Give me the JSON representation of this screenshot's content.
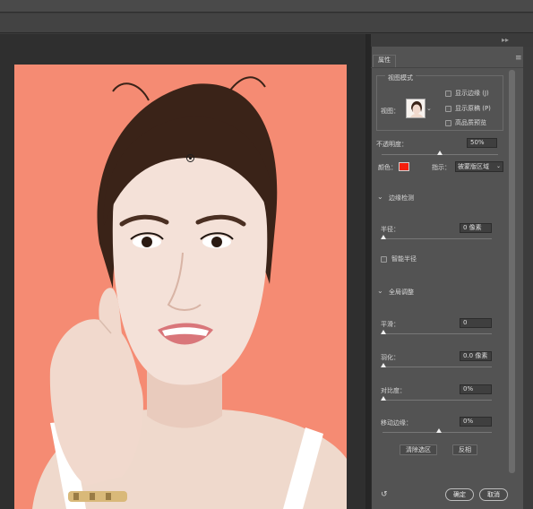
{
  "panel": {
    "tab_label": "属性",
    "view_mode_title": "视图模式",
    "view_label": "视图：",
    "options": [
      {
        "label": "显示边缘 (J)",
        "checked": false
      },
      {
        "label": "显示原稿 (P)",
        "checked": false
      },
      {
        "label": "高品质预览",
        "checked": false
      }
    ],
    "opacity_label": "不透明度：",
    "opacity_value": "50%",
    "opacity_level": 0.5,
    "color_label": "颜色：",
    "color_value": "#f51f0d",
    "indicate_label": "指示：",
    "indicate_value": "被蒙版区域",
    "edge_detection_title": "边缘检测",
    "radius_label": "半径：",
    "radius_value": "0 像素",
    "radius_level": 0,
    "smart_radius_label": "智能半径",
    "global_refine_title": "全局调整",
    "smooth_label": "平滑：",
    "smooth_value": "0",
    "smooth_level": 0,
    "feather_label": "羽化：",
    "feather_value": "0.0 像素",
    "feather_level": 0,
    "contrast_label": "对比度：",
    "contrast_value": "0%",
    "contrast_level": 0,
    "shift_edge_label": "移动边缘：",
    "shift_edge_value": "0%",
    "shift_edge_level": 0.5,
    "clear_selection_label": "清除选区",
    "invert_label": "反相",
    "ok_label": "确定",
    "cancel_label": "取消"
  },
  "canvas": {
    "background_color": "#f58b73"
  },
  "icons": {
    "collapse": "double-chevron-right-icon",
    "panel_menu": "panel-menu-icon",
    "undo": "reset-icon",
    "target": "target-icon"
  }
}
